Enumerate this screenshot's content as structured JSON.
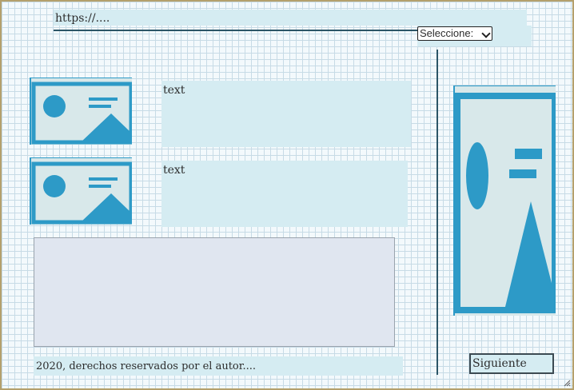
{
  "address": {
    "url": "https://...."
  },
  "selector": {
    "selected": "Seleccione:"
  },
  "items": [
    {
      "text": "text",
      "image_icon": "image-icon"
    },
    {
      "text": "text",
      "image_icon": "image-icon"
    }
  ],
  "sidebar": {
    "image_icon": "image-icon"
  },
  "footer": {
    "copyright": "2020, derechos reservados por el autor...."
  },
  "pagination": {
    "next_label": "Siguiente"
  },
  "colors": {
    "accent": "#2d9ac7",
    "panel": "#d5ecf2",
    "grid": "#c7dbe6",
    "border": "#b4a06c"
  }
}
